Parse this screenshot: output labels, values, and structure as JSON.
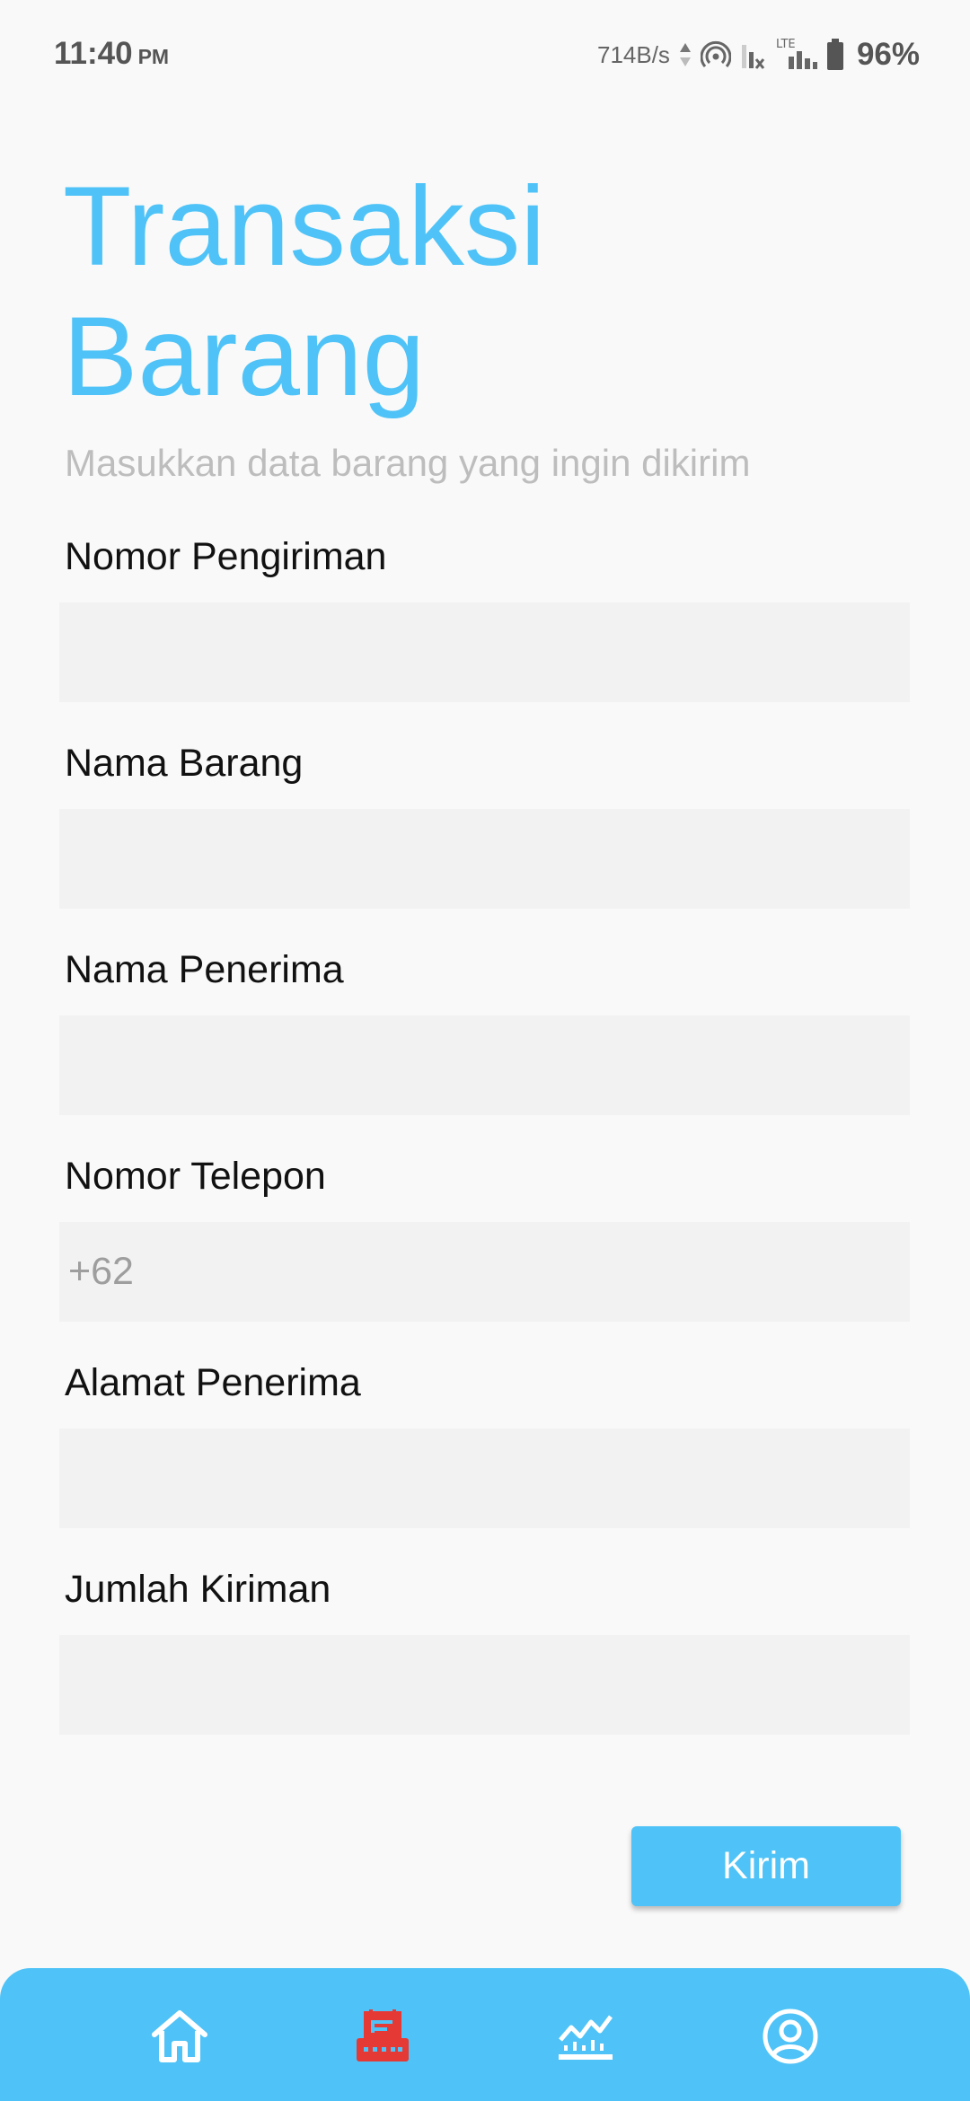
{
  "status_bar": {
    "time": "11:40",
    "ampm": "PM",
    "net_speed": "714B/s",
    "network_type": "LTE",
    "battery": "96%"
  },
  "header": {
    "title": "Transaksi Barang",
    "subtitle": "Masukkan data barang yang ingin dikirim"
  },
  "form": {
    "fields": [
      {
        "label": "Nomor Pengiriman",
        "value": "",
        "placeholder": ""
      },
      {
        "label": "Nama Barang",
        "value": "",
        "placeholder": ""
      },
      {
        "label": "Nama Penerima",
        "value": "",
        "placeholder": ""
      },
      {
        "label": "Nomor Telepon",
        "value": "",
        "placeholder": "+62"
      },
      {
        "label": "Alamat Penerima",
        "value": "",
        "placeholder": ""
      },
      {
        "label": "Jumlah Kiriman",
        "value": "",
        "placeholder": ""
      }
    ],
    "submit_label": "Kirim"
  },
  "bottom_nav": {
    "items": [
      {
        "icon": "home-icon",
        "active": false
      },
      {
        "icon": "transaction-icon",
        "active": true
      },
      {
        "icon": "chart-icon",
        "active": false
      },
      {
        "icon": "profile-icon",
        "active": false
      }
    ]
  },
  "colors": {
    "accent": "#4fc3f7",
    "active_nav": "#e53935",
    "nav_icon": "#ffffff",
    "subtitle": "#bdbdbd",
    "input_bg": "#f2f2f2"
  }
}
